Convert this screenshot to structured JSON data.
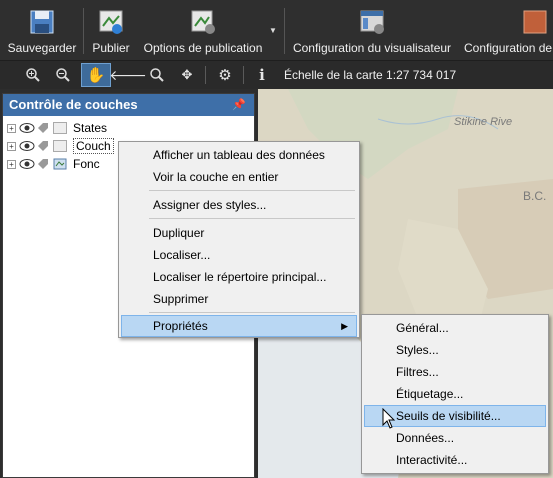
{
  "ribbon": {
    "save": "Sauvegarder",
    "publish": "Publier",
    "publish_options": "Options de publication",
    "viewer_config": "Configuration du visualisateur",
    "config_cut": "Configuration de"
  },
  "toolbar": {
    "scale_label": "Échelle de la carte 1:27 734 017"
  },
  "layers_panel": {
    "title": "Contrôle de couches",
    "pin": "ꟷ",
    "layers": [
      {
        "name": "States"
      },
      {
        "name": "Couch"
      },
      {
        "name": "Fonc"
      }
    ]
  },
  "map": {
    "labels": [
      "Stikine Rive",
      "B.C."
    ]
  },
  "context_menu": {
    "items": [
      "Afficher un tableau des données",
      "Voir la couche en entier",
      "Assigner des styles...",
      "Dupliquer",
      "Localiser...",
      "Localiser le répertoire principal...",
      "Supprimer",
      "Propriétés"
    ],
    "highlighted": "Propriétés"
  },
  "submenu": {
    "items": [
      "Général...",
      "Styles...",
      "Filtres...",
      "Étiquetage...",
      "Seuils de visibilité...",
      "Données...",
      "Interactivité..."
    ],
    "highlighted": "Seuils de visibilité..."
  },
  "colors": {
    "panel_header": "#3e6fa8",
    "menu_highlight": "#b9d7f3",
    "ribbon_bg": "#2f2f2f"
  }
}
